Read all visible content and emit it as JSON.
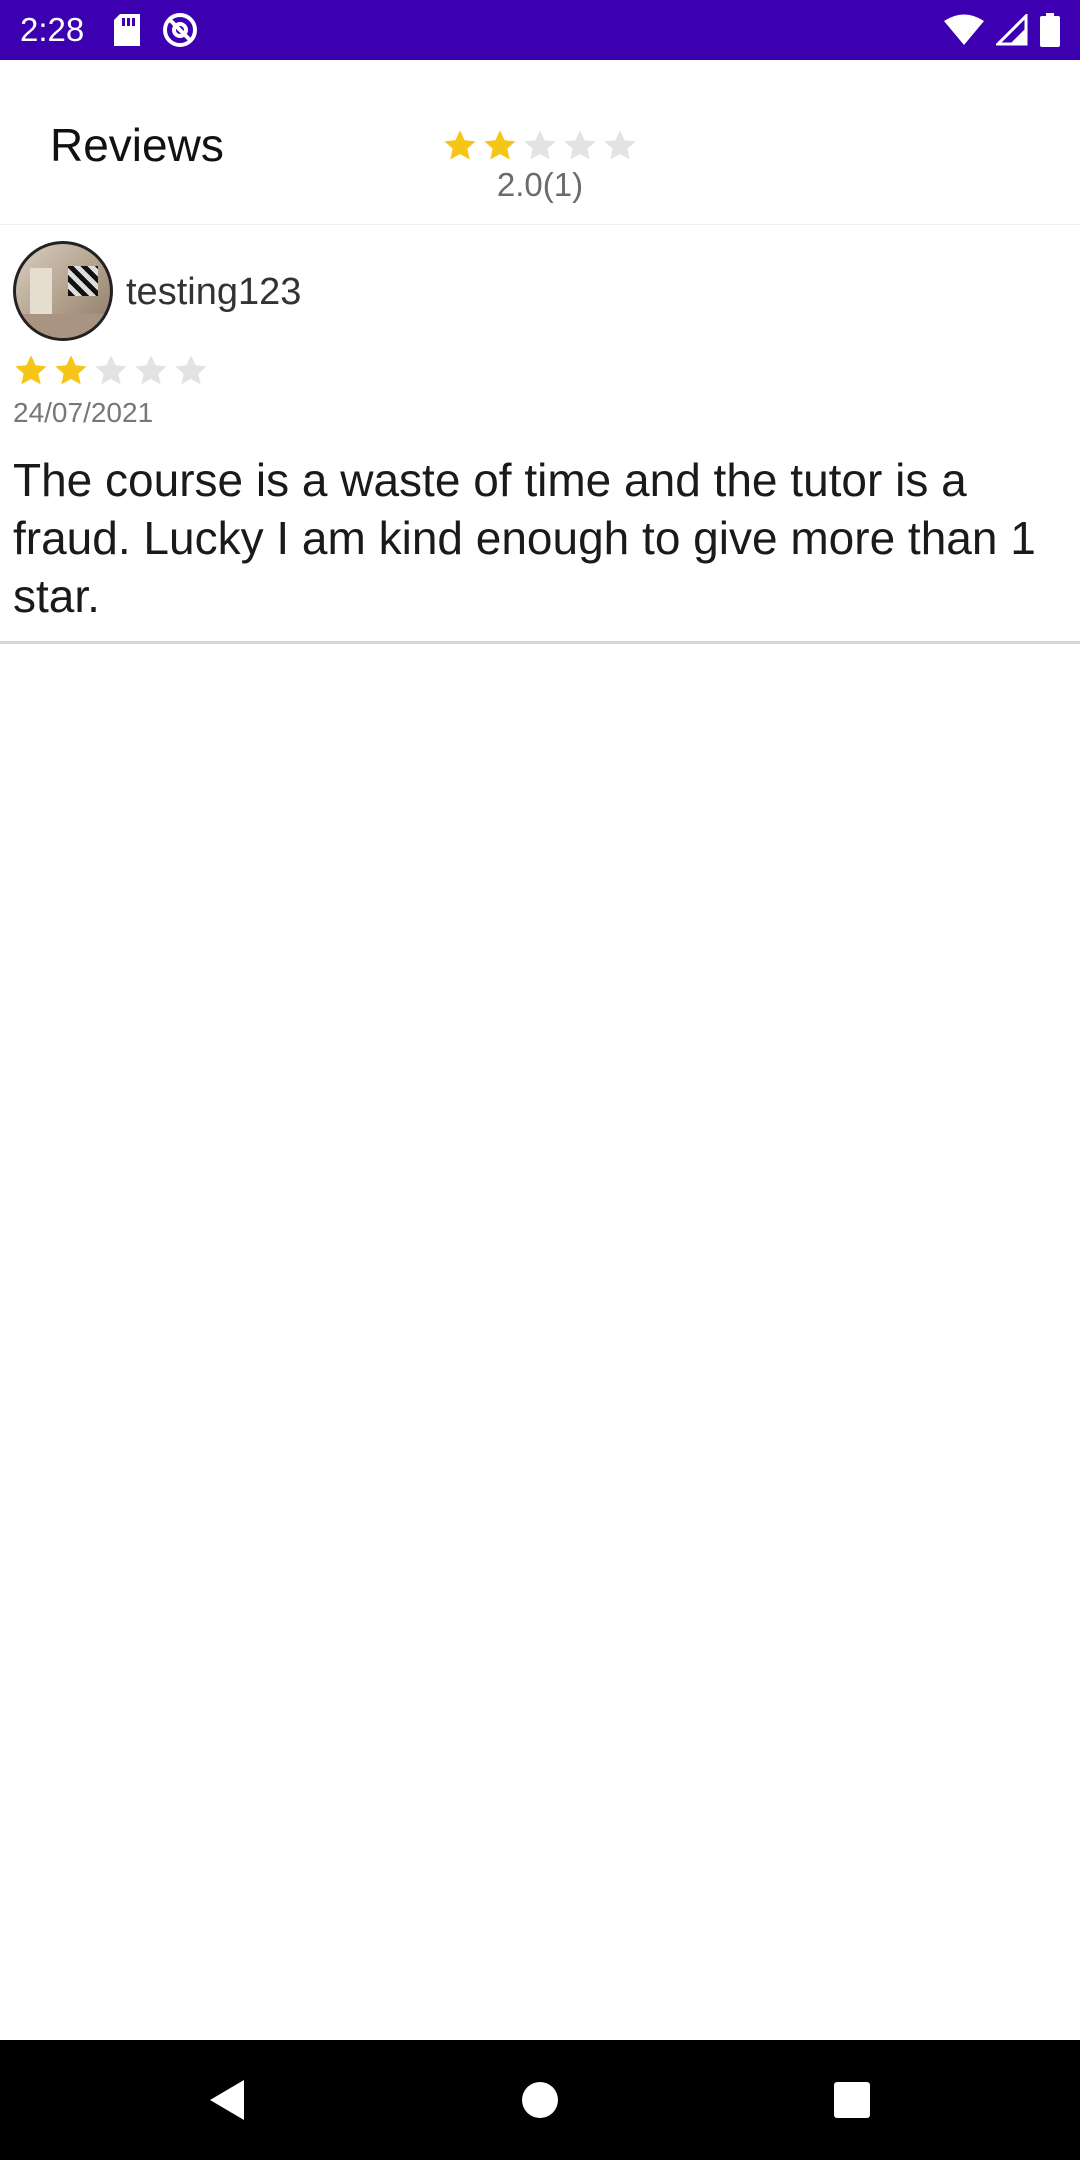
{
  "status_bar": {
    "time": "2:28",
    "icons_left": [
      "sd-card-icon",
      "at-sign-icon"
    ],
    "icons_right": [
      "wifi-icon",
      "signal-icon",
      "battery-icon"
    ]
  },
  "header": {
    "title": "Reviews",
    "average_rating": 2.0,
    "max_rating": 5,
    "rating_text": "2.0(1)"
  },
  "reviews": [
    {
      "username": "testing123",
      "rating": 2,
      "max_rating": 5,
      "date": "24/07/2021",
      "text": "The course is a waste of time and the tutor is a fraud. Lucky I am kind enough to give more than 1 star."
    }
  ],
  "navigation": {
    "buttons": [
      "back-icon",
      "home-icon",
      "recents-icon"
    ]
  },
  "colors": {
    "status_bar": "#3d00b0",
    "star_filled": "#f5c518",
    "star_empty": "#e3e3e3"
  }
}
